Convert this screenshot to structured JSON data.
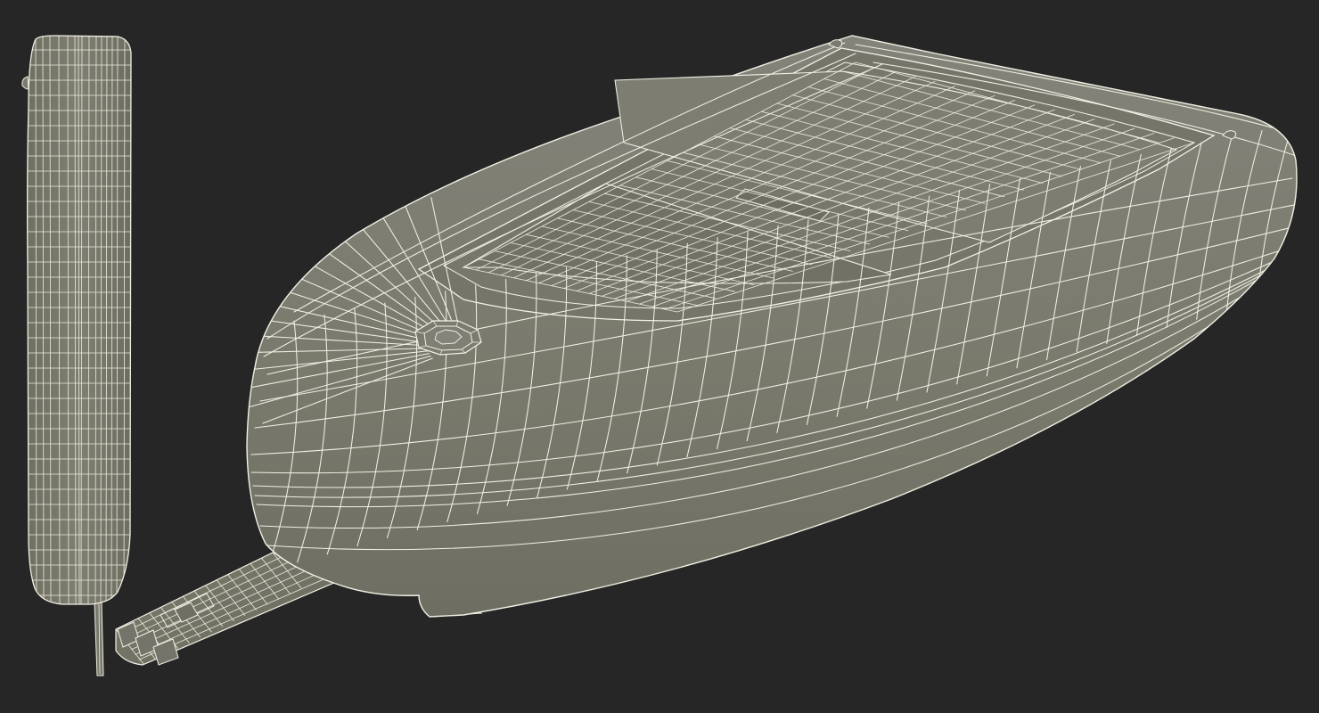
{
  "scene": {
    "background_color": "#262626",
    "surface_color": "#7b7b6d",
    "surface_shadow_color": "#6c6c5f",
    "wire_color": "#f2f0e4",
    "objects": [
      "side-profile-device",
      "test-strip",
      "glucose-meter-body"
    ]
  }
}
